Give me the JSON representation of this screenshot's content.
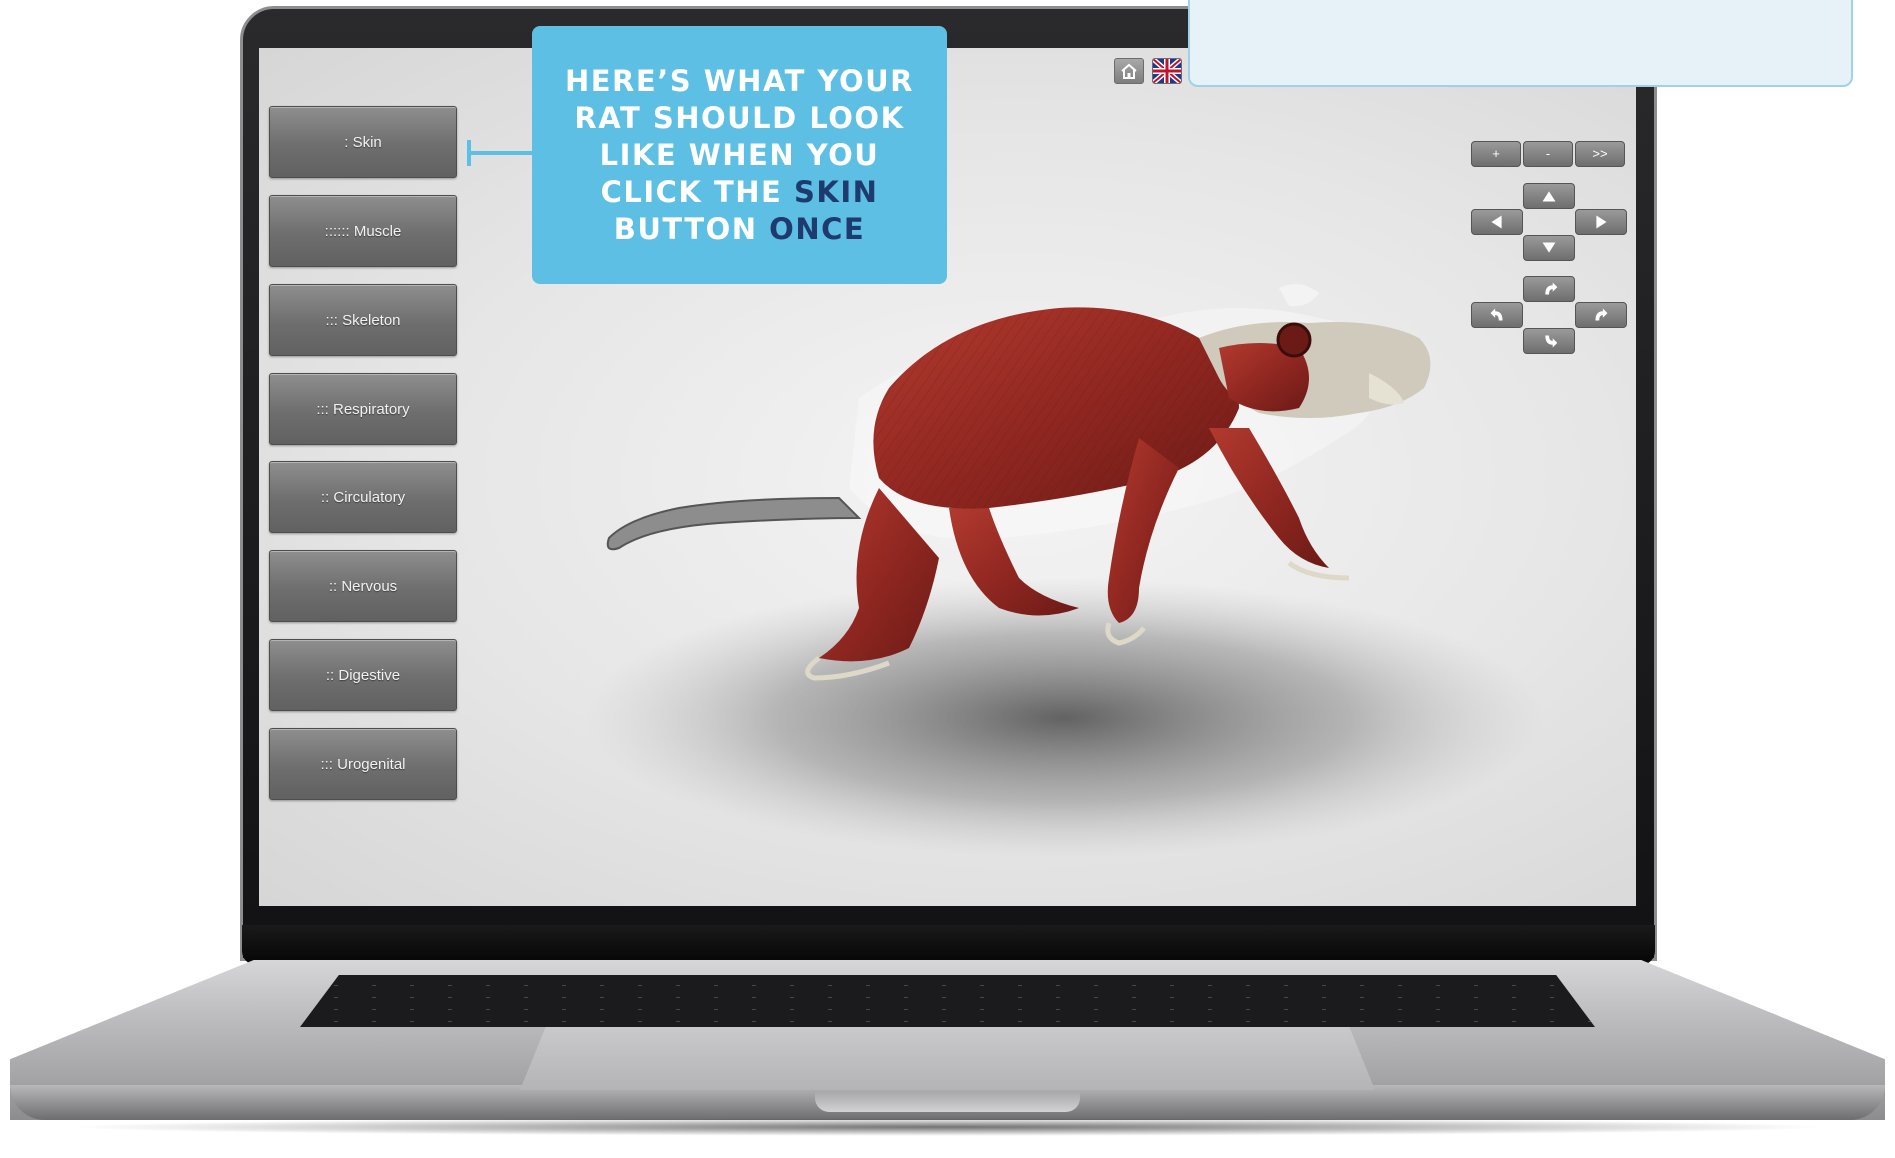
{
  "callout": {
    "line1": "HERE’S WHAT YOUR",
    "line2": "RAT SHOULD LOOK",
    "line3": "LIKE WHEN YOU",
    "line4_prefix": "CLICK THE ",
    "line4_highlight": "SKIN",
    "line5_prefix": "BUTTON ",
    "line5_highlight": "ONCE",
    "background_color": "#5cbfe3",
    "highlight_color": "#1e3a6e"
  },
  "system_buttons": [
    {
      "label": ": Skin"
    },
    {
      "label": ":::::: Muscle"
    },
    {
      "label": "::: Skeleton"
    },
    {
      "label": "::: Respiratory"
    },
    {
      "label": ":: Circulatory"
    },
    {
      "label": ":: Nervous"
    },
    {
      "label": ":: Digestive"
    },
    {
      "label": "::: Urogenital"
    }
  ],
  "top_icons": [
    "home-icon",
    "uk-flag-icon"
  ],
  "nav_controls": {
    "zoom_in": "+",
    "zoom_out": "-",
    "forward": ">>",
    "arrows": [
      "arrow-up-icon",
      "arrow-left-icon",
      "arrow-right-icon",
      "arrow-down-icon"
    ],
    "rotations": [
      "rotate-up-icon",
      "rotate-left-icon",
      "rotate-right-icon",
      "rotate-down-icon"
    ]
  },
  "model": {
    "subject": "rat",
    "muscle_color": "#9a2c24",
    "bone_color": "#d9d6c8"
  }
}
